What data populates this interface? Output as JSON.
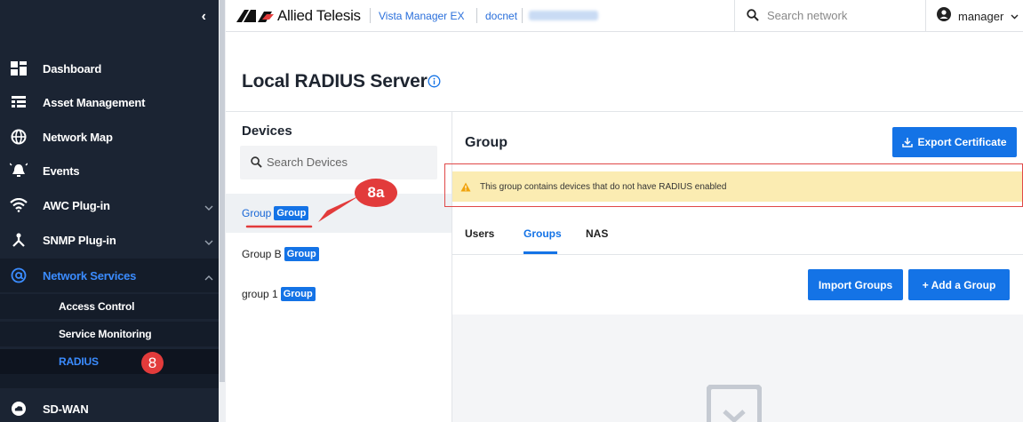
{
  "sidebar": {
    "items": [
      {
        "label": "Dashboard",
        "icon": "dashboard-icon"
      },
      {
        "label": "Asset Management",
        "icon": "list-icon"
      },
      {
        "label": "Network Map",
        "icon": "globe-icon"
      },
      {
        "label": "Events",
        "icon": "bell-icon"
      },
      {
        "label": "AWC Plug-in",
        "icon": "wifi-icon"
      },
      {
        "label": "SNMP Plug-in",
        "icon": "network-icon"
      },
      {
        "label": "Network Services",
        "icon": "at-icon"
      },
      {
        "label": "SD-WAN",
        "icon": "cloud-icon"
      }
    ],
    "sub_items": [
      {
        "label": "Access Control"
      },
      {
        "label": "Service Monitoring"
      },
      {
        "label": "RADIUS"
      }
    ],
    "step_badge": "8"
  },
  "header": {
    "brand": "Allied Telesis",
    "crumbs": [
      "Vista Manager EX",
      "docnet"
    ],
    "search_placeholder": "Search network",
    "user": "manager"
  },
  "page": {
    "title": "Local RADIUS Server"
  },
  "devices": {
    "title": "Devices",
    "search_placeholder": "Search Devices",
    "items": [
      {
        "name": "Group",
        "tag": "Group"
      },
      {
        "name": "Group B",
        "tag": "Group"
      },
      {
        "name": "group 1",
        "tag": "Group"
      }
    ]
  },
  "callout": "8a",
  "group": {
    "title": "Group",
    "export_label": "Export Certificate",
    "warning": "This group contains devices that do not have RADIUS enabled",
    "tabs": [
      "Users",
      "Groups",
      "NAS"
    ],
    "active_tab": "Groups",
    "import_label": "Import Groups",
    "add_label": "+ Add a Group"
  },
  "colors": {
    "sidebar_bg": "#1b2433",
    "accent": "#1473e6",
    "warning_bg": "#fbecb2",
    "highlight": "#e04848"
  }
}
